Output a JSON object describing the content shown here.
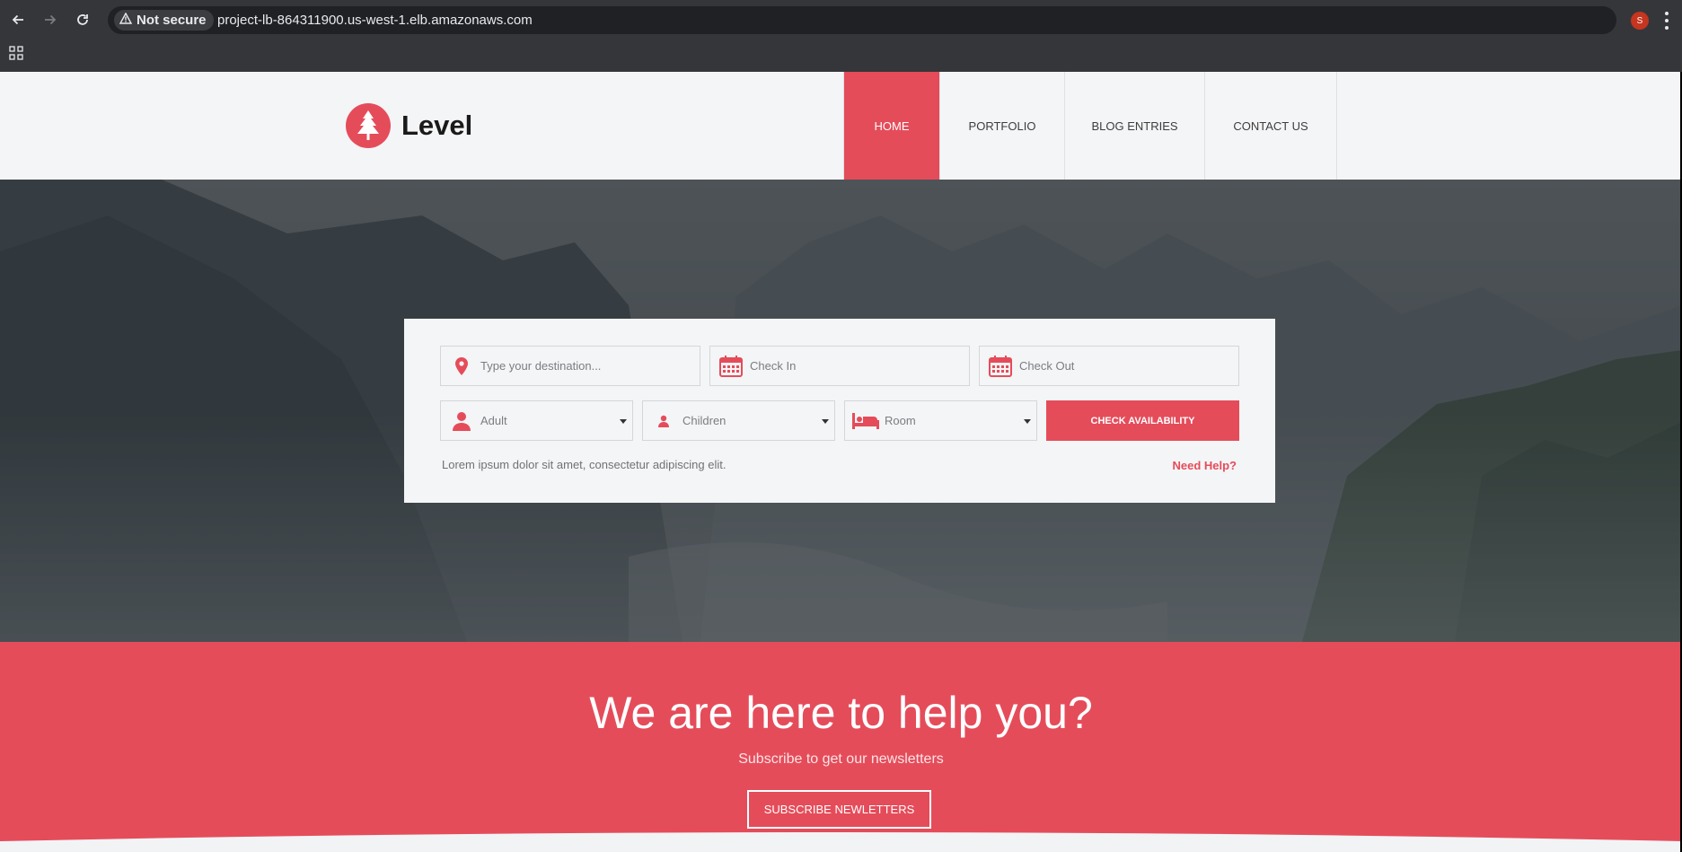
{
  "browser": {
    "security_label": "Not secure",
    "url": "project-lb-864311900.us-west-1.elb.amazonaws.com",
    "profile_initial": "S",
    "icons": [
      "back-arrow-icon",
      "forward-arrow-icon",
      "reload-icon",
      "warning-icon",
      "star-icon",
      "apps-grid-icon",
      "kebab-menu-icon"
    ]
  },
  "site": {
    "logo_text": "Level",
    "nav": [
      "HOME",
      "PORTFOLIO",
      "BLOG ENTRIES",
      "CONTACT US"
    ],
    "active_nav": "HOME",
    "accent_color": "#e54c5a"
  },
  "booking": {
    "destination_placeholder": "Type your destination...",
    "checkin_placeholder": "Check In",
    "checkout_placeholder": "Check Out",
    "adult_label": "Adult",
    "children_label": "Children",
    "room_label": "Room",
    "check_button": "CHECK AVAILABILITY",
    "note": "Lorem ipsum dolor sit amet, consectetur adipiscing elit.",
    "help_link": "Need Help?"
  },
  "newsletter": {
    "title": "We are here to help you?",
    "subtitle": "Subscribe to get our newsletters",
    "button": "SUBSCRIBE NEWLETTERS"
  }
}
